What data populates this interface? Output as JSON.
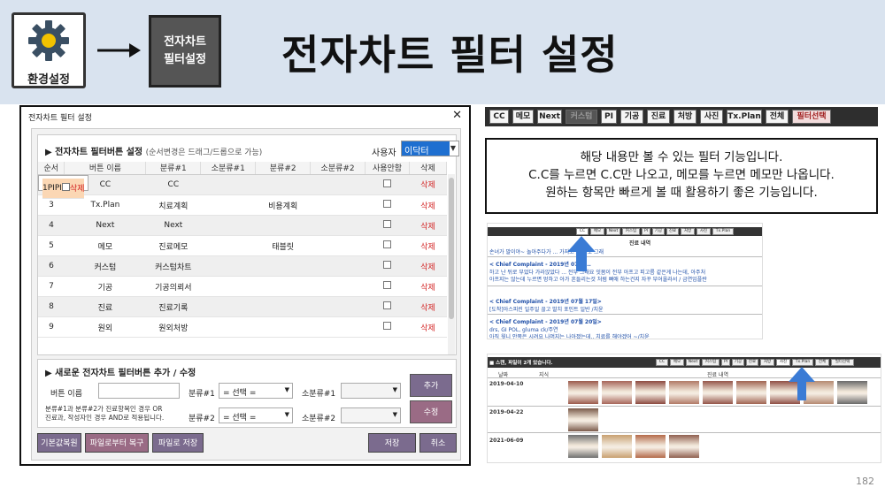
{
  "header": {
    "settings_label": "환경설정",
    "chart_box_line1": "전자차트",
    "chart_box_line2": "필터설정",
    "title": "전자차트 필터 설정"
  },
  "dialog": {
    "title": "전자차트 필터 설정",
    "close": "✕",
    "section1_title": "▶ 전자차트 필터버튼 설정",
    "section1_hint": "(순서변경은 드래그/드롭으로 가능)",
    "user_label": "사용자",
    "user_value": "이닥터",
    "columns": [
      "순서",
      "버튼 이름",
      "분류#1",
      "소분류#1",
      "분류#2",
      "소분류#2",
      "사용안함",
      "삭제"
    ],
    "rows": [
      {
        "order": "1",
        "name": "PI",
        "cat1": "PI",
        "sub1": "",
        "cat2": "",
        "sub2": "",
        "del": "삭제"
      },
      {
        "order": "2",
        "name": "CC",
        "cat1": "CC",
        "sub1": "",
        "cat2": "",
        "sub2": "",
        "del": "삭제"
      },
      {
        "order": "3",
        "name": "Tx.Plan",
        "cat1": "치료계획",
        "sub1": "",
        "cat2": "비용계획",
        "sub2": "",
        "del": "삭제"
      },
      {
        "order": "4",
        "name": "Next",
        "cat1": "Next",
        "sub1": "",
        "cat2": "",
        "sub2": "",
        "del": "삭제"
      },
      {
        "order": "5",
        "name": "메모",
        "cat1": "진료메모",
        "sub1": "",
        "cat2": "태블릿",
        "sub2": "",
        "del": "삭제"
      },
      {
        "order": "6",
        "name": "커스텀",
        "cat1": "커스텀차트",
        "sub1": "",
        "cat2": "",
        "sub2": "",
        "del": "삭제"
      },
      {
        "order": "7",
        "name": "기공",
        "cat1": "기공의뢰서",
        "sub1": "",
        "cat2": "",
        "sub2": "",
        "del": "삭제"
      },
      {
        "order": "8",
        "name": "진료",
        "cat1": "진료기록",
        "sub1": "",
        "cat2": "",
        "sub2": "",
        "del": "삭제"
      },
      {
        "order": "9",
        "name": "원외",
        "cat1": "원외처방",
        "sub1": "",
        "cat2": "",
        "sub2": "",
        "del": "삭제"
      }
    ],
    "section2_title": "▶ 새로운 전자차트 필터버튼 추가 / 수정",
    "btn_name_label": "버튼 이름",
    "cat1_label": "분류#1",
    "cat2_label": "분류#2",
    "sub1_label": "소분류#1",
    "sub2_label": "소분류#2",
    "select_placeholder": "= 선택 =",
    "note_line1": "분류#1과 분류#2가 진료항목인 경우 OR",
    "note_line2": "진료과, 작성자인 경우 AND로 적용됩니다.",
    "add_button": "추가",
    "edit_button": "수정",
    "reset_button": "기본값복원",
    "restore_file_button": "파일로부터 복구",
    "save_file_button": "파일로 저장",
    "save_button": "저장",
    "cancel_button": "취소"
  },
  "toolbar": {
    "buttons": [
      "CC",
      "메모",
      "Next",
      "커스텀",
      "PI",
      "기공",
      "진료",
      "처방",
      "사진",
      "Tx.Plan",
      "전체",
      "필터선택"
    ]
  },
  "description": {
    "line1": "해당 내용만 볼 수 있는 필터 기능입니다.",
    "line2": "C.C를 누르면 C.C만 나오고, 메모를 누르면 메모만 나옵니다.",
    "line3": "원하는 항목만 빠르게 볼 때 활용하기 좋은 기능입니다."
  },
  "shot1": {
    "mini_buttons": [
      "CC",
      "메모",
      "Next",
      "커스텀",
      "PI",
      "기공",
      "진료",
      "처방",
      "사진",
      "Tx.Plan"
    ],
    "header": "진료 내역",
    "line_a": "손녀가 말이야~ 놀아주다가 ...  가지고 그 뒤로 그래",
    "cc1": "< Chief Complaint - 2019년 07월 ...",
    "text1": "하고 난 뒤로 부었다 가라앉았다 ... 전부 그래요 잇몸이 전부 아프고 피고름 같은게 나는데, 아주처",
    "text2": "아프지는 않는데 누르면 멍하고 아가 흔들리는것 처럼 뻐애 하는건지 자꾸 부어올라서 / 금연임플란",
    "cc2": "< Chief Complaint - 2019년 07월 17일>",
    "text3": "[도착]아스피린 일주일 끊고 발치 포인트 일반 /치윤",
    "cc3": "< Chief Complaint - 2019년 07월 20일>",
    "text4": "drs, GI POL, gluma ck/주연",
    "text5": "아직 윗니 안쪽은 시려요 나머지는 나아졌는데.. 치료를 해야겠어 ~/치윤"
  },
  "shot2": {
    "bar_text": "■ 스캔, 파일이 2개 있습니다.",
    "mini_buttons": [
      "CC",
      "메모",
      "Next",
      "커스텀",
      "PI",
      "기공",
      "진료",
      "처방",
      "사진",
      "Tx.Plan",
      "전체",
      "필터선택"
    ],
    "col_date": "날짜",
    "col_mark": "지식",
    "col_record": "진료 내역",
    "dates": [
      "2019-04-10",
      "2019-04-22",
      "2021-06-09"
    ]
  },
  "page_number": "182",
  "colors": {
    "header_bg": "#d9e3ef",
    "selected_row": "#fbd7b4",
    "delete_text": "#d21f1f",
    "button_purple": "#7b6b8e",
    "button_rose": "#9a6b85",
    "arrow_blue": "#3a7bd5"
  }
}
